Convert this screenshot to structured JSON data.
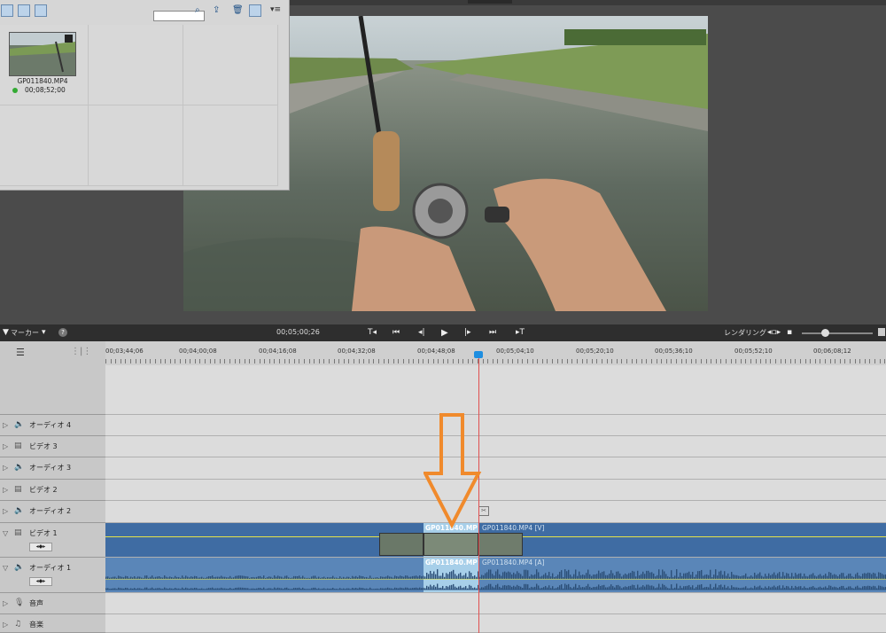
{
  "media_panel": {
    "clip": {
      "name": "GP011840.MP4",
      "duration": "00;08;52;00"
    }
  },
  "transport": {
    "marker_label": "マーカー",
    "timecode": "00;05;00;26",
    "render_label": "レンダリング"
  },
  "ruler": {
    "ticks": [
      "00;03;44;06",
      "00;04;00;08",
      "00;04;16;08",
      "00;04;32;08",
      "00;04;48;08",
      "00;05;04;10",
      "00;05;20;10",
      "00;05;36;10",
      "00;05;52;10",
      "00;06;08;12"
    ]
  },
  "tracks": {
    "audio4": "オーディオ 4",
    "video3": "ビデオ 3",
    "audio3": "オーディオ 3",
    "video2": "ビデオ 2",
    "audio2": "オーディオ 2",
    "video1": "ビデオ 1",
    "audio1": "オーディオ 1",
    "voice": "音声",
    "music": "音楽"
  },
  "timeline_clips": {
    "video_sel_label": "GP011840.MP",
    "video_label": "GP011840.MP4 [V]",
    "audio_sel_label": "GP011840.MP",
    "audio_label": "GP011840.MP4 [A]"
  },
  "colors": {
    "annotation_arrow": "#f08a2c",
    "playhead": "#e05050",
    "video_track": "#3f6ca3",
    "audio_track": "#5a86b8"
  }
}
